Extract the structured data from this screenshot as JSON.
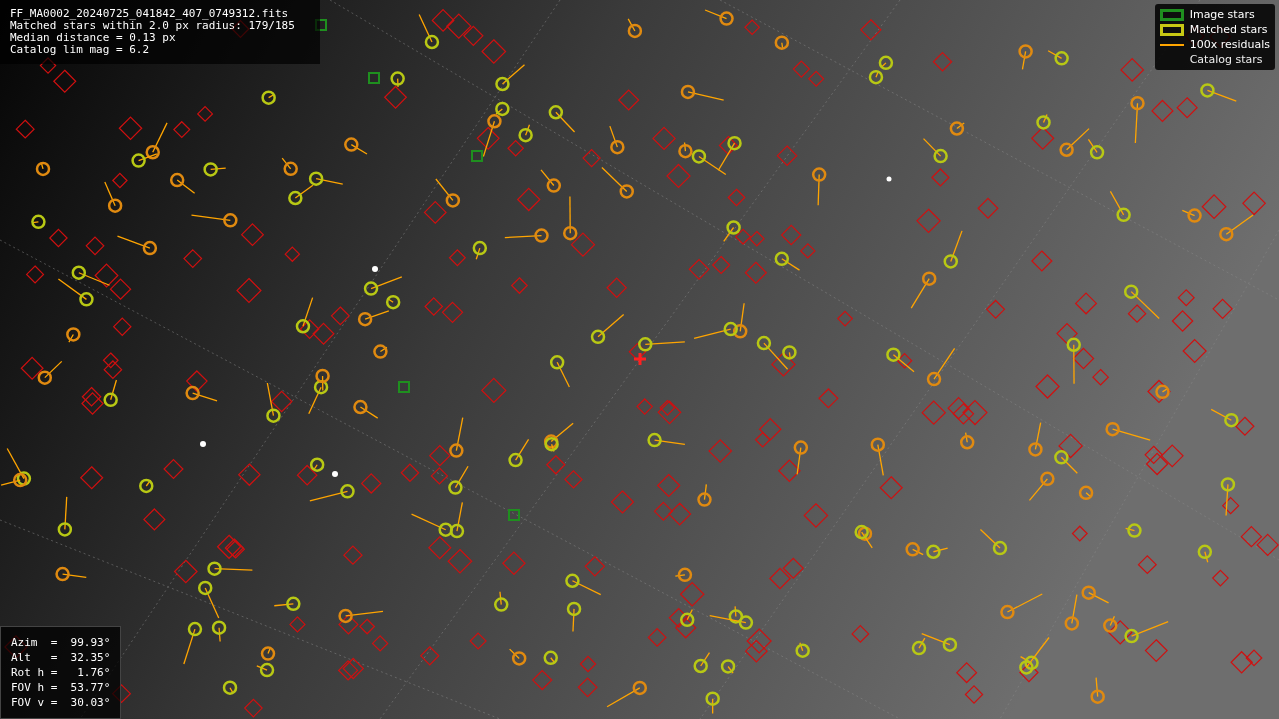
{
  "info": {
    "lines": [
      "FF_MA0002_20240725_041842_407_0749312.fits",
      "Matched stars within 2.0 px radius: 179/185",
      "Median distance = 0.13 px",
      "Catalog lim mag = 6.2"
    ]
  },
  "legend": [
    {
      "label": "Image stars",
      "kind": "square",
      "color": "#1f8f1f"
    },
    {
      "label": "Matched stars",
      "kind": "square",
      "color": "#c8c814"
    },
    {
      "label": "100x residuals",
      "kind": "line",
      "color": "#ffa500"
    },
    {
      "label": "Catalog stars",
      "kind": "none"
    }
  ],
  "pointing": {
    "rows": [
      "Azim  =  99.93°",
      "Alt   =  32.35°",
      "Rot h =   1.76°",
      "FOV h =  53.77°",
      "FOV v =  30.03°"
    ]
  }
}
